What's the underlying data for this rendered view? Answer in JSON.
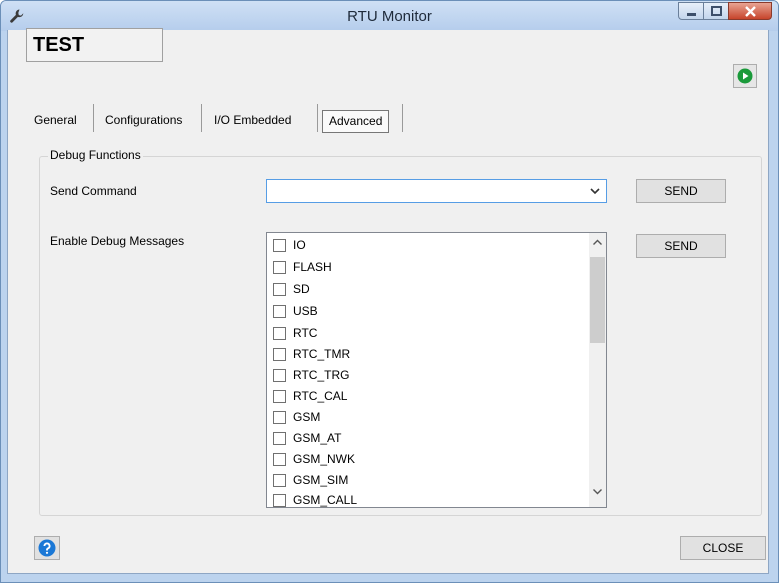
{
  "window": {
    "title": "RTU Monitor"
  },
  "device": {
    "name": "TEST"
  },
  "tabs": [
    {
      "label": "General"
    },
    {
      "label": "Configurations"
    },
    {
      "label": "I/O Embedded"
    },
    {
      "label": "Advanced",
      "selected": true
    }
  ],
  "debug": {
    "group_title": "Debug Functions",
    "send_command_label": "Send Command",
    "send_command_value": "",
    "send_command_button": "SEND",
    "enable_messages_label": "Enable Debug Messages",
    "enable_messages_button": "SEND",
    "options": [
      "IO",
      "FLASH",
      "SD",
      "USB",
      "RTC",
      "RTC_TMR",
      "RTC_TRG",
      "RTC_CAL",
      "GSM",
      "GSM_AT",
      "GSM_NWK",
      "GSM_SIM",
      "GSM_CALL"
    ]
  },
  "footer": {
    "close_label": "CLOSE"
  },
  "colors": {
    "accent_green": "#1a9a3a",
    "help_blue": "#1b78d6",
    "close_red": "#c7442b"
  }
}
